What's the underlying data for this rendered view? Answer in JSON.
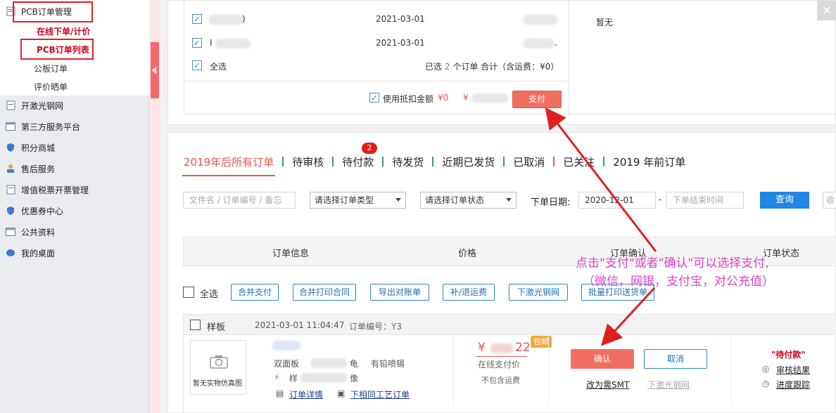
{
  "sidebar": {
    "sections": [
      {
        "label": "PCB订单管理",
        "icon": "document-icon"
      },
      {
        "label": "开激光钢网",
        "icon": "document-icon"
      },
      {
        "label": "第三方服务平台",
        "icon": "window-icon"
      },
      {
        "label": "积分商城",
        "icon": "shield-icon"
      },
      {
        "label": "售后服务",
        "icon": "user-icon"
      },
      {
        "label": "增值税票开票管理",
        "icon": "document-icon"
      },
      {
        "label": "优惠券中心",
        "icon": "shield-icon"
      },
      {
        "label": "公共资料",
        "icon": "window-icon"
      },
      {
        "label": "我的桌面",
        "icon": "chat-icon"
      }
    ],
    "sub_items": [
      "在线下单/计价",
      "PCB订单列表",
      "公板订单",
      "评价晒单"
    ]
  },
  "pay_panel": {
    "rows": [
      {
        "date": "2021-03-01",
        "name_suffix": ")"
      },
      {
        "date": "2021-03-01",
        "name_prefix": "I",
        "amount_suffix": "."
      }
    ],
    "select_all": "全选",
    "summary_prefix": "已选",
    "selected_count": "2",
    "summary_suffix": "个订单 合计（含运费：¥0）",
    "use_balance": "使用抵扣金额",
    "balance_amount": "¥0",
    "currency": "¥",
    "pay_button": "支付",
    "note": "暂无",
    "close": "×"
  },
  "tabs": [
    {
      "label": "2019年后所有订单",
      "active": true
    },
    {
      "label": "待审核"
    },
    {
      "label": "待付款",
      "badge": "2"
    },
    {
      "label": "待发货"
    },
    {
      "label": "近期已发货"
    },
    {
      "label": "已取消"
    },
    {
      "label": "已关注"
    },
    {
      "label": "2019 年前订单"
    }
  ],
  "filters": {
    "keyword_placeholder": "文件名 / 订单编号 / 备忘",
    "order_type": "请选择订单类型",
    "order_status": "请选择订单状态",
    "date_label": "下单日期:",
    "start_date": "2020-12-01",
    "end_placeholder": "下单结束时间",
    "dash": "-",
    "query_button": "查询",
    "collect": "收"
  },
  "table": {
    "headers": [
      "订单信息",
      "价格",
      "订单确认",
      "订单状态"
    ]
  },
  "actions": {
    "select_all": "全选",
    "buttons": [
      "合并支付",
      "合并打印合同",
      "导出对账单",
      "补/退运费",
      "下激光钢网",
      "批量打印送货单"
    ]
  },
  "order": {
    "type": "样板",
    "time": "2021-03-01 11:04:47",
    "order_no_label": "订单编号：Y3",
    "thumb_caption": "暂无实物仿真图",
    "spec1_prefix": "双面板",
    "spec1_mid": "龟",
    "spec1_suffix": "有铅喷锡",
    "spec2_prefix": "样",
    "spec2_suffix": "像",
    "detail_link": "订单详情",
    "same_link": "下相同工艺订单",
    "price_prefix": "¥",
    "price_suffix": "22",
    "free_ship": "包邮",
    "pay_method": "在线支付价",
    "excl_ship": "不包含运费",
    "confirm_button": "确认",
    "cancel_button": "取消",
    "to_smt": "改为需SMT",
    "laser": "下激光钢网",
    "status": "\"待付款\"",
    "review": "审核结果",
    "track": "进度跟踪"
  },
  "annotation": {
    "line1": "点击\"支付\"或者\"确认\"可以选择支付,",
    "line2": "（微信，网银，支付宝，对公充值）"
  },
  "colors": {
    "accent": "#e5574a",
    "primary": "#1f87e5",
    "annotation": "#d946c8",
    "arrow": "#e02020"
  }
}
